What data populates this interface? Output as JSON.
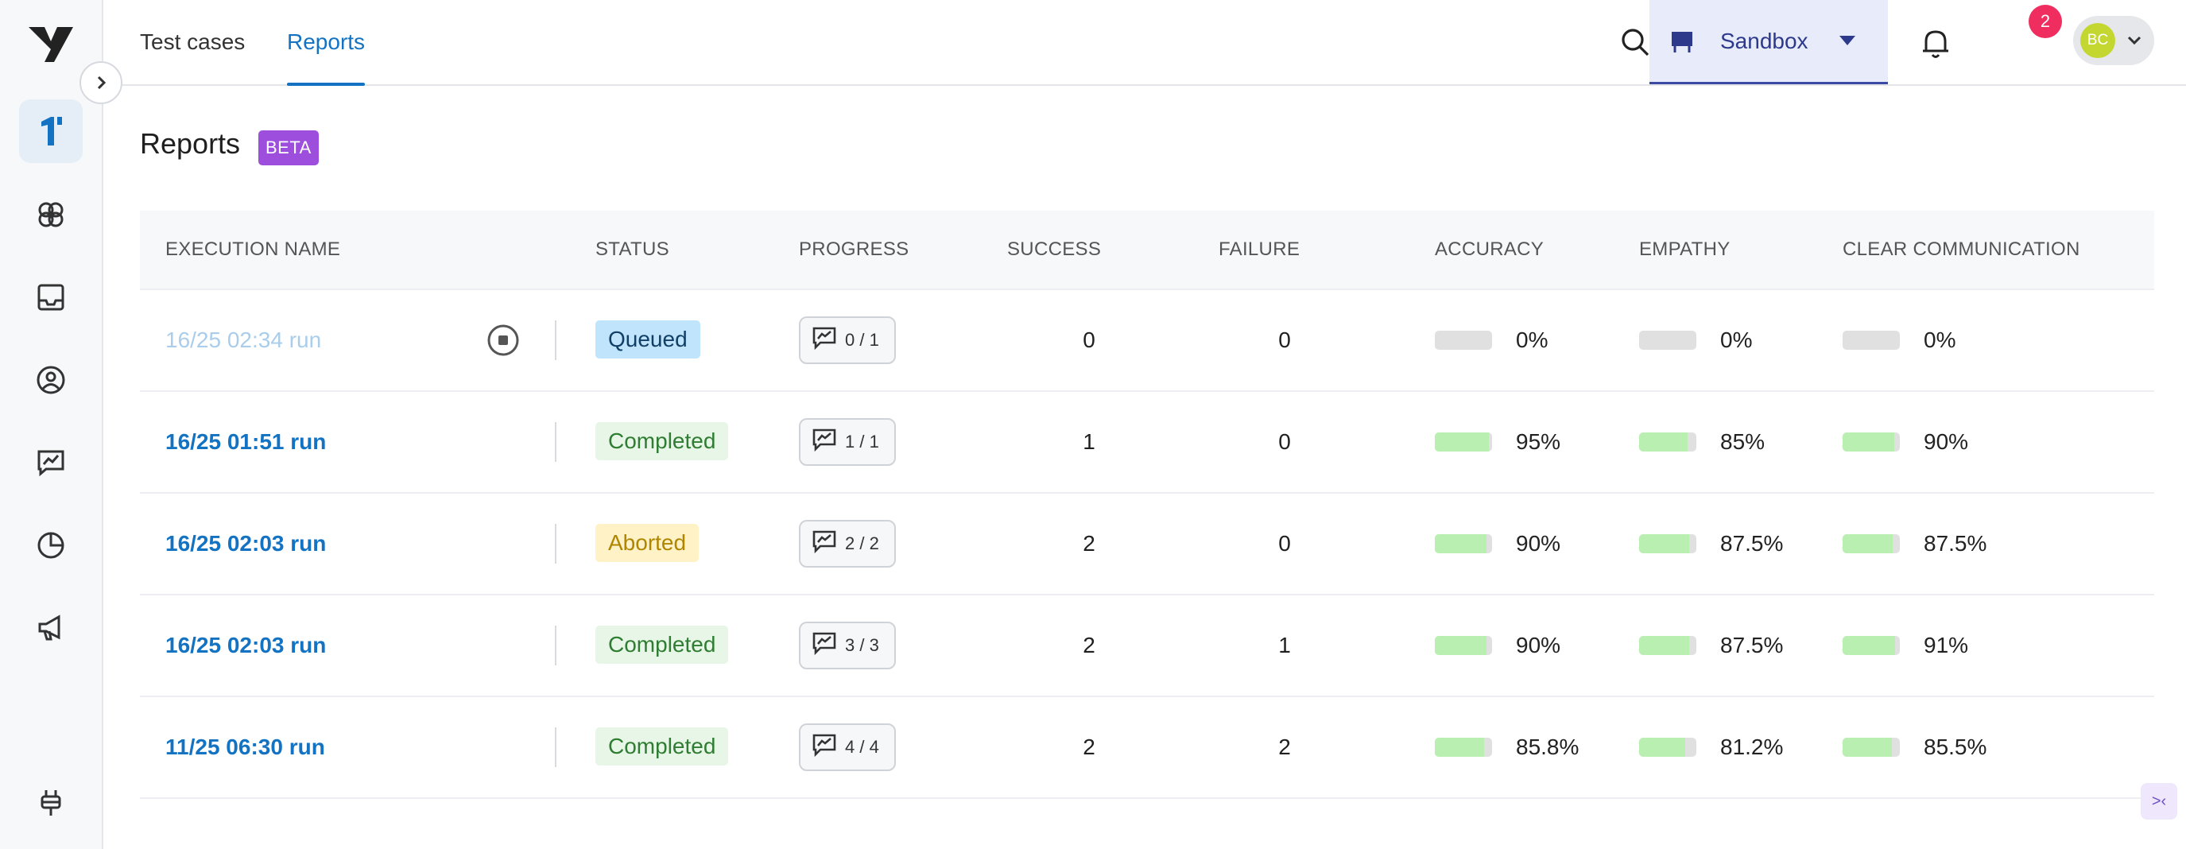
{
  "nav": {
    "tabs": [
      {
        "label": "Test cases",
        "active": false
      },
      {
        "label": "Reports",
        "active": true
      }
    ],
    "environment": "Sandbox",
    "notification_count": "2",
    "user_initials": "BC"
  },
  "sidebar": {
    "items": [
      {
        "icon": "one-icon",
        "active": true
      },
      {
        "icon": "brain-icon",
        "active": false
      },
      {
        "icon": "inbox-icon",
        "active": false
      },
      {
        "icon": "user-circle-icon",
        "active": false
      },
      {
        "icon": "chat-chart-icon",
        "active": false
      },
      {
        "icon": "pie-chart-icon",
        "active": false
      },
      {
        "icon": "megaphone-icon",
        "active": false
      },
      {
        "icon": "plug-icon",
        "active": false
      }
    ]
  },
  "page": {
    "title": "Reports",
    "badge": "BETA"
  },
  "table": {
    "headers": {
      "execution_name": "EXECUTION NAME",
      "status": "STATUS",
      "progress": "PROGRESS",
      "success": "SUCCESS",
      "failure": "FAILURE",
      "accuracy": "ACCURACY",
      "empathy": "EMPATHY",
      "clear_communication": "CLEAR COMMUNICATION"
    },
    "rows": [
      {
        "name": "16/25 02:34 run",
        "status": "Queued",
        "status_type": "queued",
        "progress": "0 / 1",
        "success": "0",
        "failure": "0",
        "accuracy": "0%",
        "accuracy_value": 0,
        "empathy": "0%",
        "empathy_value": 0,
        "clear": "0%",
        "clear_value": 0,
        "stoppable": true
      },
      {
        "name": "16/25 01:51 run",
        "status": "Completed",
        "status_type": "completed",
        "progress": "1 / 1",
        "success": "1",
        "failure": "0",
        "accuracy": "95%",
        "accuracy_value": 95,
        "empathy": "85%",
        "empathy_value": 85,
        "clear": "90%",
        "clear_value": 90,
        "stoppable": false
      },
      {
        "name": "16/25 02:03 run",
        "status": "Aborted",
        "status_type": "aborted",
        "progress": "2 / 2",
        "success": "2",
        "failure": "0",
        "accuracy": "90%",
        "accuracy_value": 90,
        "empathy": "87.5%",
        "empathy_value": 87.5,
        "clear": "87.5%",
        "clear_value": 87.5,
        "stoppable": false
      },
      {
        "name": "16/25 02:03 run",
        "status": "Completed",
        "status_type": "completed",
        "progress": "3 / 3",
        "success": "2",
        "failure": "1",
        "accuracy": "90%",
        "accuracy_value": 90,
        "empathy": "87.5%",
        "empathy_value": 87.5,
        "clear": "91%",
        "clear_value": 91,
        "stoppable": false
      },
      {
        "name": "11/25 06:30 run",
        "status": "Completed",
        "status_type": "completed",
        "progress": "4 / 4",
        "success": "2",
        "failure": "2",
        "accuracy": "85.8%",
        "accuracy_value": 85.8,
        "empathy": "81.2%",
        "empathy_value": 81.2,
        "clear": "85.5%",
        "clear_value": 85.5,
        "stoppable": false
      }
    ]
  },
  "colors": {
    "accent": "#1373c2",
    "beta": "#9d4edd",
    "bar_fill": "#b9efb1",
    "notification": "#ef2d5e"
  }
}
